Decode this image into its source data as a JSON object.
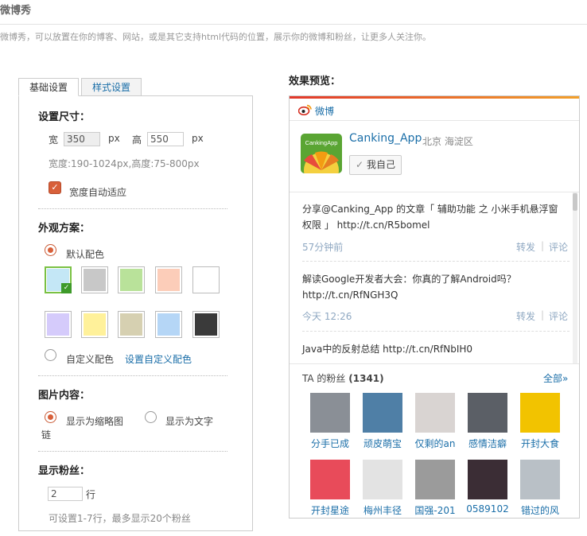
{
  "page": {
    "title": "微博秀",
    "description": "微博秀，可以放置在你的博客、网站，或是其它支持html代码的位置，展示你的微博和粉丝，让更多人关注你。"
  },
  "tabs": [
    {
      "label": "基础设置",
      "active": true
    },
    {
      "label": "样式设置",
      "active": false
    }
  ],
  "size": {
    "title": "设置尺寸：",
    "width_label": "宽",
    "width_value": "350",
    "height_label": "高",
    "height_value": "550",
    "unit": "px",
    "hint": "宽度:190-1024px,高度:75-800px",
    "auto_width_label": "宽度自动适应",
    "auto_width_checked": true
  },
  "appearance": {
    "title": "外观方案：",
    "default_label": "默认配色",
    "custom_label": "自定义配色",
    "custom_link": "设置自定义配色",
    "selected": "default",
    "swatches": [
      "#c4e7f6",
      "#c8c8c8",
      "#b9e29a",
      "#fccdb9",
      "#ffffff",
      "#d5cbfb",
      "#fff19a",
      "#d6d0b1",
      "#b5d6f6",
      "#3a3a3a"
    ],
    "selected_swatch": 0
  },
  "image": {
    "title": "图片内容：",
    "thumb_label": "显示为缩略图",
    "text_label": "显示为文字",
    "text_label_cont": "链",
    "selected": "thumb"
  },
  "fans": {
    "title": "显示粉丝：",
    "rows_value": "2",
    "rows_unit": "行",
    "hint": "可设置1-7行，最多显示20个粉丝"
  },
  "preview": {
    "title": "效果预览：",
    "brand": "微博",
    "user_name": "Canking_App",
    "location": "北京 海淀区",
    "me_button": "我自己",
    "avatar_text": "CankingApp",
    "posts": [
      {
        "text": "分享@Canking_App 的文章「 辅助功能 之 小米手机悬浮窗权限 」 http://t.cn/R5bomel",
        "time": "57分钟前"
      },
      {
        "text": "解读Google开发者大会：你真的了解Android吗？ http://t.cn/RfNGH3Q",
        "time": "今天 12:26"
      },
      {
        "text": "Java中的反射总结 http://t.cn/RfNbIH0",
        "time": ""
      }
    ],
    "forward_label": "转发",
    "comment_label": "评论",
    "separator": "|",
    "fans_title_prefix": "TA 的粉丝",
    "fans_count": "(1341)",
    "fans_all": "全部»",
    "fan_list": [
      {
        "name": "分手已成",
        "color": "#8a8f96"
      },
      {
        "name": "顽皮萌宝",
        "color": "#4f7fa6"
      },
      {
        "name": "仅剩的an",
        "color": "#d9d4d2"
      },
      {
        "name": "感情洁癖",
        "color": "#5b5f66"
      },
      {
        "name": "开封大食",
        "color": "#f2c300"
      },
      {
        "name": "开封星途",
        "color": "#e84b5a"
      },
      {
        "name": "梅州丰径",
        "color": "#e3e3e3"
      },
      {
        "name": "国强-201",
        "color": "#9b9b9b"
      },
      {
        "name": "0589102",
        "color": "#3b2d35"
      },
      {
        "name": "错过的风",
        "color": "#b9c0c6"
      }
    ]
  }
}
